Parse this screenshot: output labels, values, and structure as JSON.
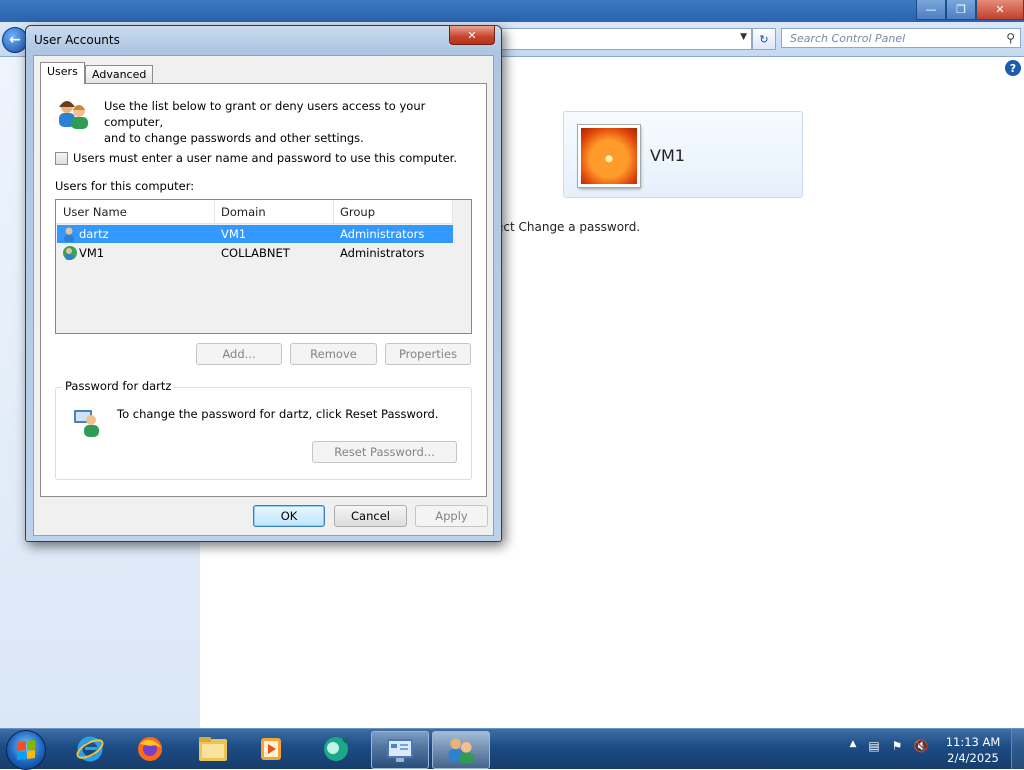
{
  "control_panel": {
    "search_placeholder": "Search Control Panel",
    "account_name": "VM1",
    "body_text_fragment": "ect Change a password."
  },
  "dialog": {
    "title": "User Accounts",
    "tabs": [
      {
        "label": "Users",
        "active": true
      },
      {
        "label": "Advanced",
        "active": false
      }
    ],
    "intro_line1": "Use the list below to grant or deny users access to your computer,",
    "intro_line2": "and to change passwords and other settings.",
    "require_login_label": "Users must enter a user name and password to use this computer.",
    "require_login_checked": false,
    "users_section_label": "Users for this computer:",
    "columns": [
      "User Name",
      "Domain",
      "Group"
    ],
    "users": [
      {
        "name": "dartz",
        "domain": "VM1",
        "group": "Administrators",
        "selected": true
      },
      {
        "name": "VM1",
        "domain": "COLLABNET",
        "group": "Administrators",
        "selected": false
      }
    ],
    "buttons": {
      "add": "Add...",
      "remove": "Remove",
      "properties": "Properties",
      "reset_password": "Reset Password...",
      "ok": "OK",
      "cancel": "Cancel",
      "apply": "Apply"
    },
    "password_group_label": "Password for dartz",
    "password_text": "To change the password for dartz, click Reset Password."
  },
  "taskbar": {
    "pinned": [
      "internet-explorer-icon",
      "firefox-icon",
      "file-explorer-icon",
      "media-player-icon",
      "network-app-icon"
    ],
    "running": [
      "control-panel-icon",
      "user-accounts-icon"
    ],
    "time": "11:13 AM",
    "date": "2/4/2025"
  },
  "colors": {
    "selection": "#3399ff",
    "taskbar": "#1d4b83",
    "title_close": "#c7432a"
  }
}
